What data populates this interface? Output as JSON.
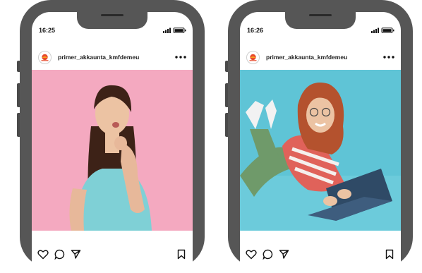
{
  "phones": [
    {
      "status_time": "16:25",
      "username": "primer_akkaunta_kmfdemeu",
      "photo": {
        "background_color": "#f4a9c0",
        "subject": "woman-thinking",
        "top_color": "#7fd0d6"
      }
    },
    {
      "status_time": "16:26",
      "username": "primer_akkaunta_kmfdemeu",
      "photo": {
        "background_color": "#5fc4d6",
        "subject": "woman-lying-with-laptop",
        "top_color": "#e0625a"
      }
    }
  ],
  "icons": [
    "signal-icon",
    "battery-icon",
    "more-options-icon",
    "heart-icon",
    "comment-icon",
    "share-icon",
    "bookmark-icon"
  ],
  "colors": {
    "frame": "#565656",
    "avatar_logo": "#e8492b"
  }
}
